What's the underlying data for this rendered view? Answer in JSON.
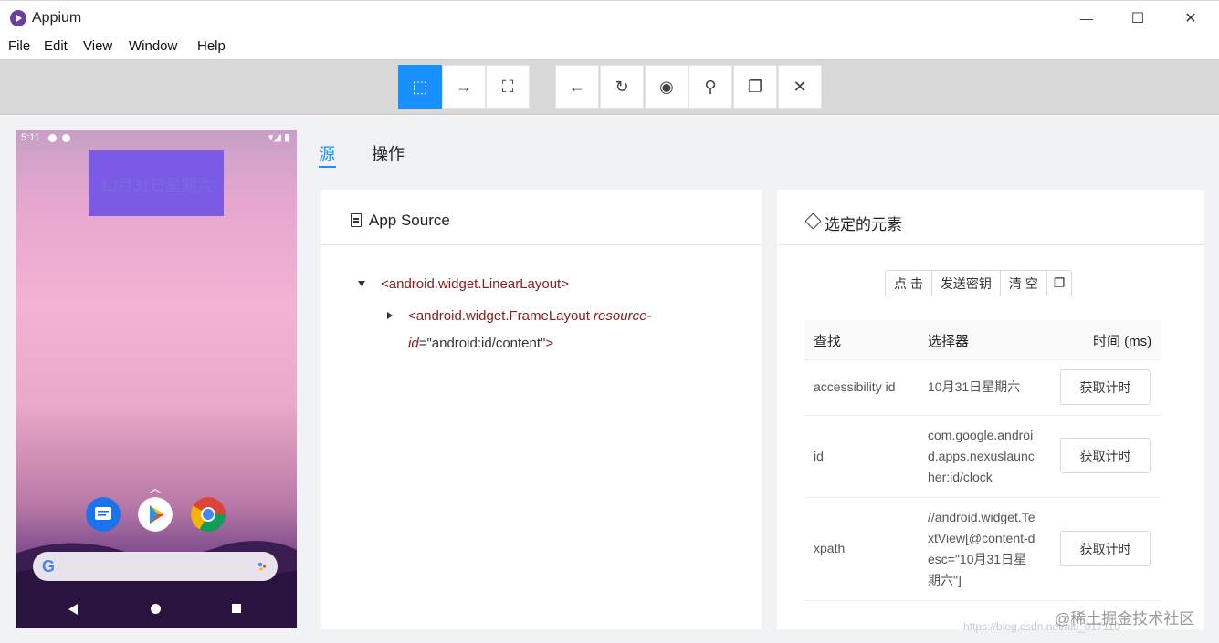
{
  "window": {
    "title": "Appium",
    "minimize": "—",
    "maximize": "☐",
    "close": "✕"
  },
  "menu": [
    "File",
    "Edit",
    "View",
    "Window",
    "Help"
  ],
  "toolbar": {
    "group1": [
      {
        "icon": "select-element-icon",
        "glyph": "⬚",
        "active": true
      },
      {
        "icon": "swipe-icon",
        "glyph": "→",
        "active": false
      },
      {
        "icon": "tap-coordinates-icon",
        "glyph": "⛶",
        "active": false
      }
    ],
    "group2": [
      {
        "icon": "back-icon",
        "glyph": "←"
      },
      {
        "icon": "refresh-icon",
        "glyph": "↻"
      },
      {
        "icon": "eye-icon",
        "glyph": "◉"
      },
      {
        "icon": "search-icon",
        "glyph": "⚲"
      },
      {
        "icon": "copy-icon",
        "glyph": "❐"
      },
      {
        "icon": "quit-session-icon",
        "glyph": "✕"
      }
    ]
  },
  "device": {
    "status_time": "5:11",
    "status_right": "▾◢ ▮",
    "clock_text": "10月31日星期六",
    "chevron": "︿",
    "google_letter": "G"
  },
  "tabs": [
    {
      "label": "源",
      "active": true
    },
    {
      "label": "操作",
      "active": false
    }
  ],
  "source_panel": {
    "title": "App Source",
    "node1": "<android.widget.LinearLayout>",
    "node2_open": "<android.widget.FrameLayout ",
    "node2_attr1": "resource-",
    "node2_attr2": "id",
    "node2_eq": "=",
    "node2_val": "\"android:id/content\"",
    "node2_close": ">"
  },
  "element_panel": {
    "title": "选定的元素",
    "actions": [
      "点 击",
      "发送密钥",
      "清 空",
      "❐"
    ],
    "columns": {
      "find": "查找",
      "selector": "选择器",
      "time": "时间 (ms)"
    },
    "rows": [
      {
        "find": "accessibility id",
        "selector": "10月31日星期六",
        "button": "获取计时"
      },
      {
        "find": "id",
        "selector": "com.google.android.apps.nexuslauncher:id/clock",
        "button": "获取计时"
      },
      {
        "find": "xpath",
        "selector": "//android.widget.TextView[@content-desc=\"10月31日星期六\"]",
        "button": "获取计时"
      }
    ]
  },
  "watermark": "@稀土掘金技术社区",
  "watermark_url": "https://blog.csdn.net/akl_017110"
}
